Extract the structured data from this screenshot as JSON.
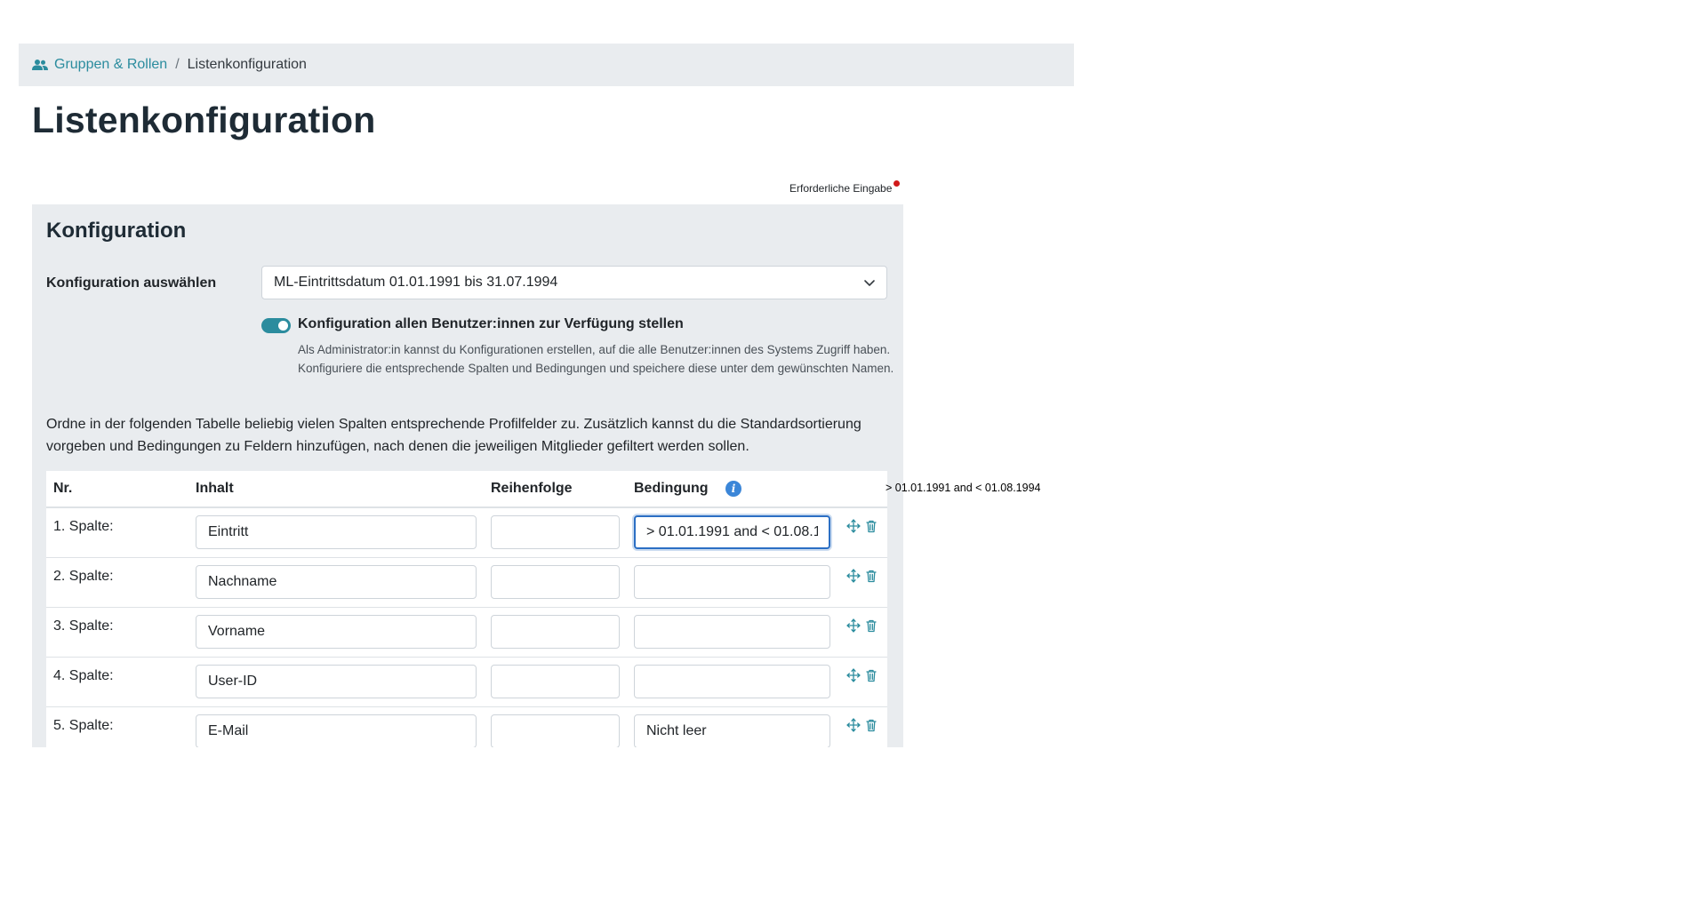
{
  "breadcrumb": {
    "icon": "users-icon",
    "link_label": "Gruppen & Rollen",
    "separator": "/",
    "current": "Listenkonfiguration"
  },
  "page": {
    "title": "Listenkonfiguration",
    "required_hint": "Erforderliche Eingabe"
  },
  "card": {
    "title": "Konfiguration",
    "select_label": "Konfiguration auswählen",
    "select_value": "ML-Eintrittsdatum 01.01.1991 bis 31.07.1994",
    "toggle_on": true,
    "toggle_label": "Konfiguration allen Benutzer:innen zur Verfügung stellen",
    "toggle_help": "Als Administrator:in kannst du Konfigurationen erstellen, auf die alle Benutzer:innen des Systems Zugriff haben. Konfiguriere die entsprechende Spalten und Bedingungen und speichere diese unter dem ge­wünschten Namen.",
    "intro": "Ordne in der folgenden Tabelle beliebig vielen Spalten entsprechende Profilfelder zu. Zusätzlich kannst du die Standardsortierung vorgeben und Bedingungen zu Feldern hinzufügen, nach denen die jeweiligen Mitglieder gefiltert werden sollen."
  },
  "table": {
    "headers": {
      "nr": "Nr.",
      "inhalt": "Inhalt",
      "reihenfolge": "Reihenfolge",
      "bedingung": "Bedingung"
    },
    "rows": [
      {
        "nr": "1. Spalte:",
        "inhalt": "Eintritt",
        "reihenfolge": "",
        "bedingung": "> 01.01.1991 and < 01.08.1"
      },
      {
        "nr": "2. Spalte:",
        "inhalt": "Nachname",
        "reihenfolge": "",
        "bedingung": ""
      },
      {
        "nr": "3. Spalte:",
        "inhalt": "Vorname",
        "reihenfolge": "",
        "bedingung": ""
      },
      {
        "nr": "4. Spalte:",
        "inhalt": "User-ID",
        "reihenfolge": "",
        "bedingung": ""
      },
      {
        "nr": "5. Spalte:",
        "inhalt": "E-Mail",
        "reihenfolge": "",
        "bedingung": "Nicht leer"
      }
    ]
  },
  "tooltip": "> 01.01.1991 and < 01.08.1994",
  "colors": {
    "accent": "#2b8c9e",
    "card_bg": "#e9ecef",
    "required": "#d11a1a",
    "info": "#3b86d8"
  }
}
